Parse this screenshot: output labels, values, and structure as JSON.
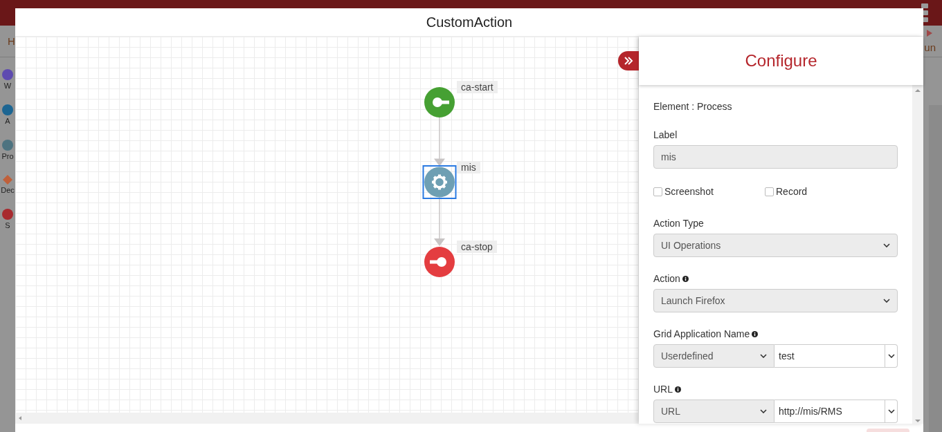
{
  "background": {
    "tab_label": "H",
    "sidebar_items": [
      {
        "label": "W",
        "kind": "circle",
        "color": "#5e4bb0"
      },
      {
        "label": "A",
        "kind": "circle",
        "color": "#1c6592"
      },
      {
        "label": "Pro",
        "kind": "circle",
        "color": "#4d7380"
      },
      {
        "label": "Dec",
        "kind": "diamond",
        "color": "#c0603a"
      },
      {
        "label": "S",
        "kind": "circle",
        "color": "#a82a2f"
      }
    ],
    "toolbar_label": "un"
  },
  "modal": {
    "title": "CustomAction",
    "flow": {
      "nodes": [
        {
          "kind": "start",
          "label": "ca-start",
          "selected": false
        },
        {
          "kind": "process",
          "label": "mis",
          "selected": true
        },
        {
          "kind": "stop",
          "label": "ca-stop",
          "selected": false
        }
      ]
    },
    "panel": {
      "title": "Configure",
      "element_info": "Element : Process",
      "fields": [
        {
          "kind": "text",
          "label": "Label",
          "value": "mis",
          "disabled": true,
          "info": false
        },
        {
          "kind": "checkboxes",
          "options": [
            {
              "label": "Screenshot",
              "checked": false
            },
            {
              "label": "Record",
              "checked": false
            }
          ]
        },
        {
          "kind": "select",
          "label": "Action Type",
          "value": "UI Operations",
          "info": false
        },
        {
          "kind": "select",
          "label": "Action",
          "value": "Launch Firefox",
          "info": true
        },
        {
          "kind": "combo",
          "label": "Grid Application Name",
          "mode": "Userdefined",
          "value": "test",
          "info": true
        },
        {
          "kind": "combo",
          "label": "URL",
          "mode": "URL",
          "value": "http://mis/RMS",
          "info": true
        }
      ]
    }
  }
}
